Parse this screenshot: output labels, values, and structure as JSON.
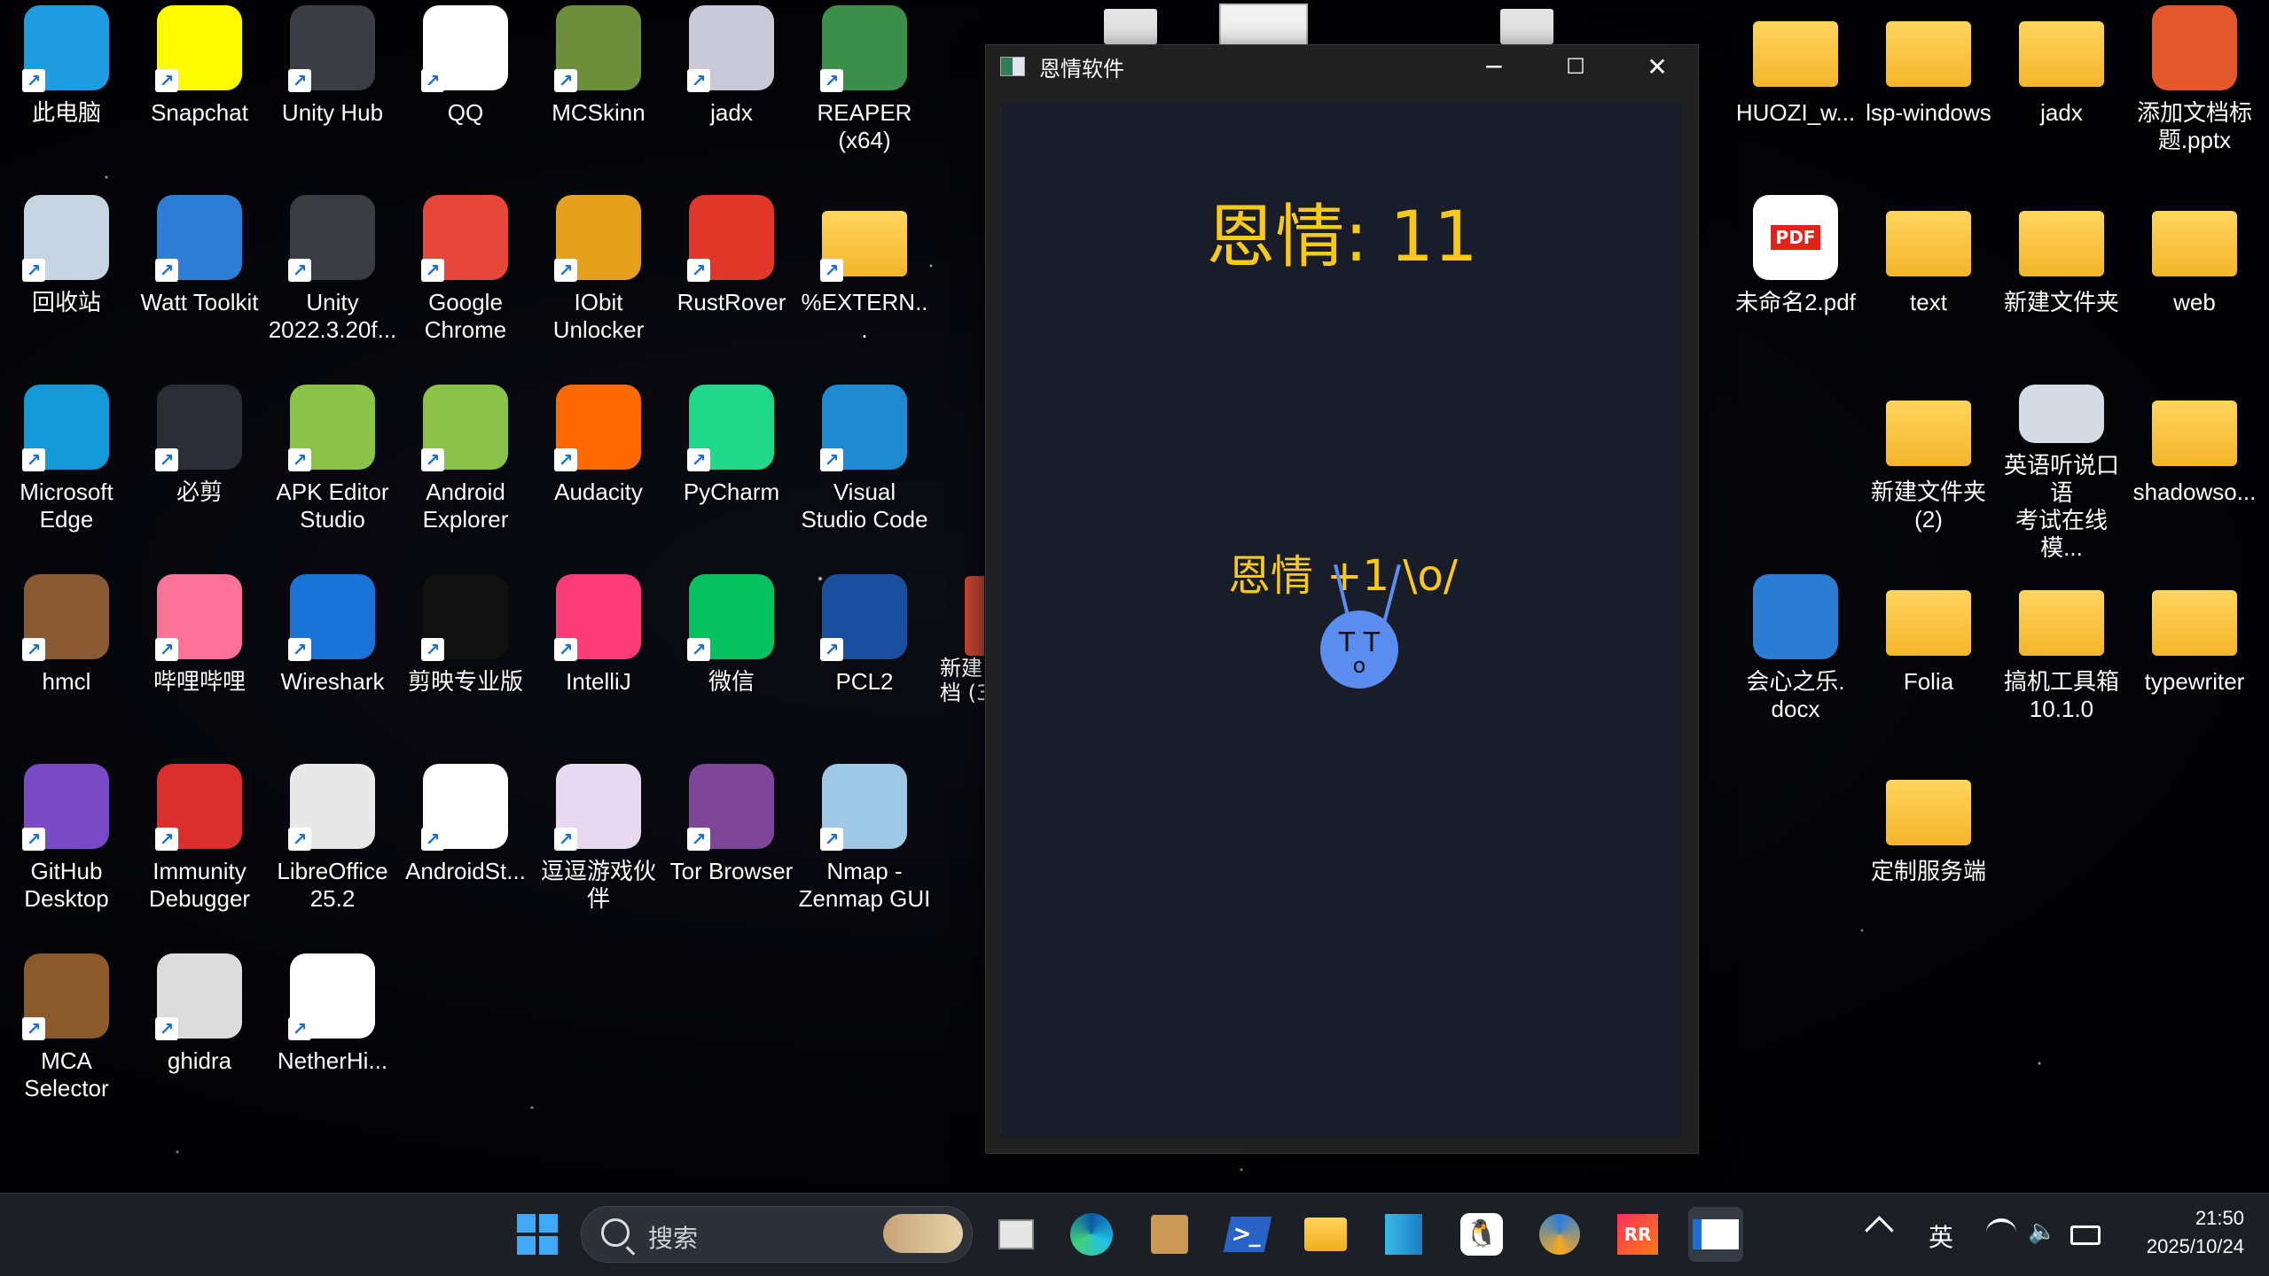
{
  "desktop": {
    "left_icons": [
      {
        "label": "此电脑",
        "icon": "monitor-icon",
        "color": "#1f9be0"
      },
      {
        "label": "Snapchat",
        "icon": "snapchat-icon",
        "color": "#fffc00"
      },
      {
        "label": "Unity Hub",
        "icon": "unity-cube-icon",
        "color": "#3a3d44"
      },
      {
        "label": "QQ",
        "icon": "qq-penguin-icon",
        "color": "#ffffff"
      },
      {
        "label": "MCSkinn",
        "icon": "mcskinn-icon",
        "color": "#6d8f3c"
      },
      {
        "label": "jadx",
        "icon": "jadx-icon",
        "color": "#c9c9d9"
      },
      {
        "label": "REAPER\n(x64)",
        "icon": "reaper-icon",
        "color": "#3b8f4a"
      },
      {
        "label": "回收站",
        "icon": "recycle-bin-icon",
        "color": "#c7d4e2"
      },
      {
        "label": "Watt Toolkit",
        "icon": "watt-toolkit-icon",
        "color": "#2e7ed8"
      },
      {
        "label": "Unity\n2022.3.20f...",
        "icon": "unity-cube-icon",
        "color": "#3a3d44"
      },
      {
        "label": "Google\nChrome",
        "icon": "chrome-icon",
        "color": "#e7463b"
      },
      {
        "label": "IObit\nUnlocker",
        "icon": "lock-icon",
        "color": "#e5a11b"
      },
      {
        "label": "RustRover",
        "icon": "rustrover-icon",
        "color": "#e1362a"
      },
      {
        "label": "%EXTERN...",
        "icon": "folder-icon",
        "color": "#f4c233"
      },
      {
        "label": "Microsoft\nEdge",
        "icon": "edge-icon",
        "color": "#1598d8"
      },
      {
        "label": "必剪",
        "icon": "bijian-icon",
        "color": "#2a2d36"
      },
      {
        "label": "APK Editor\nStudio",
        "icon": "apk-editor-icon",
        "color": "#8bc34a"
      },
      {
        "label": "Android\nExplorer",
        "icon": "android-explorer-icon",
        "color": "#8bc34a"
      },
      {
        "label": "Audacity",
        "icon": "audacity-icon",
        "color": "#ff6a00"
      },
      {
        "label": "PyCharm",
        "icon": "pycharm-icon",
        "color": "#21d789"
      },
      {
        "label": "Visual\nStudio Code",
        "icon": "vscode-icon",
        "color": "#1f8ad2"
      },
      {
        "label": "hmcl",
        "icon": "hmcl-icon",
        "color": "#8a5a34"
      },
      {
        "label": "哔哩哔哩",
        "icon": "bilibili-icon",
        "color": "#fb7299"
      },
      {
        "label": "Wireshark",
        "icon": "wireshark-fin-icon",
        "color": "#1a74d8"
      },
      {
        "label": "剪映专业版",
        "icon": "capcut-icon",
        "color": "#111111"
      },
      {
        "label": "IntelliJ",
        "icon": "intellij-icon",
        "color": "#fc3b7b"
      },
      {
        "label": "微信",
        "icon": "wechat-icon",
        "color": "#07c160"
      },
      {
        "label": "PCL2",
        "icon": "pcl2-icon",
        "color": "#1a4fa0"
      },
      {
        "label": "GitHub\nDesktop",
        "icon": "github-desktop-icon",
        "color": "#7a49c6"
      },
      {
        "label": "Immunity\nDebugger",
        "icon": "immunity-debugger-icon",
        "color": "#d9302d"
      },
      {
        "label": "LibreOffice\n25.2",
        "icon": "libreoffice-icon",
        "color": "#e8e8e8"
      },
      {
        "label": "AndroidSt...",
        "icon": "android-studio-icon",
        "color": "#ffffff"
      },
      {
        "label": "逗逗游戏伙伴",
        "icon": "anime-avatar-icon",
        "color": "#e8d8f0"
      },
      {
        "label": "Tor Browser",
        "icon": "tor-browser-icon",
        "color": "#7d4698"
      },
      {
        "label": "Nmap -\nZenmap GUI",
        "icon": "nmap-eye-icon",
        "color": "#9fc7e6"
      },
      {
        "label": "MCA\nSelector",
        "icon": "mca-selector-icon",
        "color": "#8b5a2b"
      },
      {
        "label": "ghidra",
        "icon": "ghidra-icon",
        "color": "#dcdcdc"
      },
      {
        "label": "NetherHi...",
        "icon": "netherhi-icon",
        "color": "#ffffff"
      }
    ],
    "right_icons": [
      {
        "label": "HUOZI_w...",
        "icon": "folder-icon"
      },
      {
        "label": "lsp-windows",
        "icon": "folder-icon"
      },
      {
        "label": "jadx",
        "icon": "folder-icon"
      },
      {
        "label": "添加文档标\n题.pptx",
        "icon": "pptx-icon"
      },
      {
        "label": "未命名2.pdf",
        "icon": "pdf-icon"
      },
      {
        "label": "text",
        "icon": "folder-icon"
      },
      {
        "label": "新建文件夹",
        "icon": "folder-icon"
      },
      {
        "label": "web",
        "icon": "folder-icon"
      },
      {
        "label": "新建文件夹\n(2)",
        "icon": "folder-icon"
      },
      {
        "label": "英语听说口语\n考试在线模...",
        "icon": "exam-app-icon"
      },
      {
        "label": "shadowso...",
        "icon": "folder-icon"
      },
      {
        "label": "会心之乐.\ndocx",
        "icon": "docx-icon"
      },
      {
        "label": "Folia",
        "icon": "folder-icon"
      },
      {
        "label": "搞机工具箱\n10.1.0",
        "icon": "folder-icon"
      },
      {
        "label": "typewriter",
        "icon": "folder-icon"
      },
      {
        "label": "定制服务端",
        "icon": "folder-icon"
      }
    ],
    "partial_label": "新建\n档 (3"
  },
  "window": {
    "title": "恩情软件",
    "minimize": "─",
    "maximize": "☐",
    "close": "✕",
    "score_text": "恩情: 11",
    "plus_text": "恩情 +1 \\o/",
    "mascot_face": "T T",
    "mascot_mouth": "o"
  },
  "taskbar": {
    "search_placeholder": "搜索",
    "ime": "英",
    "time": "21:50",
    "date": "2025/10/24",
    "pinned": [
      "task-view",
      "edge",
      "package",
      "terminal",
      "file-explorer",
      "azure-storage",
      "qq",
      "watt-toolkit",
      "rustrover",
      "enqing-app"
    ]
  }
}
